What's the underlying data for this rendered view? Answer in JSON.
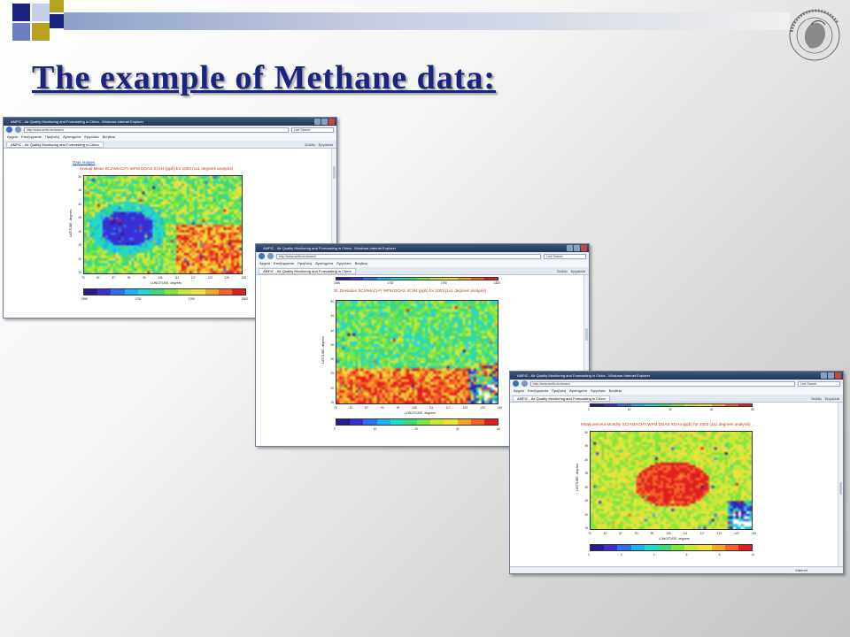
{
  "slide": {
    "title": "The example of Methane data:"
  },
  "colors": {
    "title": "#1a237e",
    "sq_navy": "#1a237e",
    "sq_olive": "#b7a21f",
    "sq_blue": "#6b7ec2",
    "sq_light": "#c6cde8",
    "map_title": "#d0301e"
  },
  "windows": [
    {
      "titlebar": "AMFIC - Air Quality Monitoring and Forecasting in China - Windows Internet Explorer",
      "url": "http://www.amfic.eu/search",
      "search": "Live Search",
      "menu": [
        "Αρχείο",
        "Επεξεργασία",
        "Προβολή",
        "Αγαπημένα",
        "Εργαλεία",
        "Βοήθεια"
      ],
      "tab": "AMFIC - Air Quality Monitoring and Forecasting in China",
      "tools": [
        "Σελίδα",
        "Εργαλεία"
      ],
      "link": "Data images",
      "map_title": "Annual Mean SCIAMACHY WFM DOAS XCH4 (ppb) for 2003 (1x1 degrees analysis)",
      "xlabel": "LONGITUDE, degrees",
      "ylabel": "LATITUDE, degrees",
      "xticks": [
        "75",
        "81",
        "87",
        "93",
        "99",
        "105",
        "111",
        "117",
        "123",
        "129",
        "135"
      ],
      "yticks": [
        "50",
        "45",
        "40",
        "35",
        "30",
        "25",
        "20",
        "15"
      ],
      "cbar_ticks": [
        "1690",
        "1730",
        "1790",
        "1820"
      ],
      "status": ""
    },
    {
      "titlebar": "AMFIC - Air Quality Monitoring and Forecasting in China - Windows Internet Explorer",
      "url": "http://www.amfic.eu/search",
      "search": "Live Search",
      "menu": [
        "Αρχείο",
        "Επεξεργασία",
        "Προβολή",
        "Αγαπημένα",
        "Εργαλεία",
        "Βοήθεια"
      ],
      "tab": "AMFIC - Air Quality Monitoring and Forecasting in China",
      "tools": [
        "Σελίδα",
        "Εργαλεία"
      ],
      "top_cbar_ticks": [
        "1690",
        "1730",
        "1790",
        "1820"
      ],
      "map_title": "St. Deviation SCIAMACHY WFM DOAS XCH4 (ppb) for 2003 (1x1 degrees analysis)",
      "xlabel": "LONGITUDE, degrees",
      "ylabel": "LATITUDE, degrees",
      "xticks": [
        "75",
        "81",
        "87",
        "93",
        "99",
        "105",
        "111",
        "117",
        "123",
        "129",
        "135"
      ],
      "yticks": [
        "50",
        "45",
        "40",
        "35",
        "30",
        "25",
        "20",
        "15"
      ],
      "cbar_ticks": [
        "0",
        "10",
        "20",
        "40",
        "60"
      ],
      "status": ""
    },
    {
      "titlebar": "AMFIC - Air Quality Monitoring and Forecasting in China - Windows Internet Explorer",
      "url": "http://www.amfic.eu/search",
      "search": "Live Search",
      "menu": [
        "Αρχείο",
        "Επεξεργασία",
        "Προβολή",
        "Αγαπημένα",
        "Εργαλεία",
        "Βοήθεια"
      ],
      "tab": "AMFIC - Air Quality Monitoring and Forecasting in China",
      "tools": [
        "Σελίδα",
        "Εργαλεία"
      ],
      "top_cbar_ticks": [
        "0",
        "10",
        "20",
        "40",
        "60"
      ],
      "map_title": "Measurement Monthly SCIAMACHY WFM DOAS XCH4 (ppb) for 2003 (1x1 degrees analysis)",
      "xlabel": "LONGITUDE, degrees",
      "ylabel": "LATITUDE, degrees",
      "xticks": [
        "75",
        "81",
        "87",
        "93",
        "99",
        "105",
        "111",
        "117",
        "123",
        "129",
        "135"
      ],
      "yticks": [
        "50",
        "45",
        "40",
        "35",
        "30",
        "25",
        "20",
        "15"
      ],
      "cbar_ticks": [
        "0",
        "2",
        "4",
        "6",
        "8",
        "10"
      ],
      "status": "Internet"
    }
  ]
}
